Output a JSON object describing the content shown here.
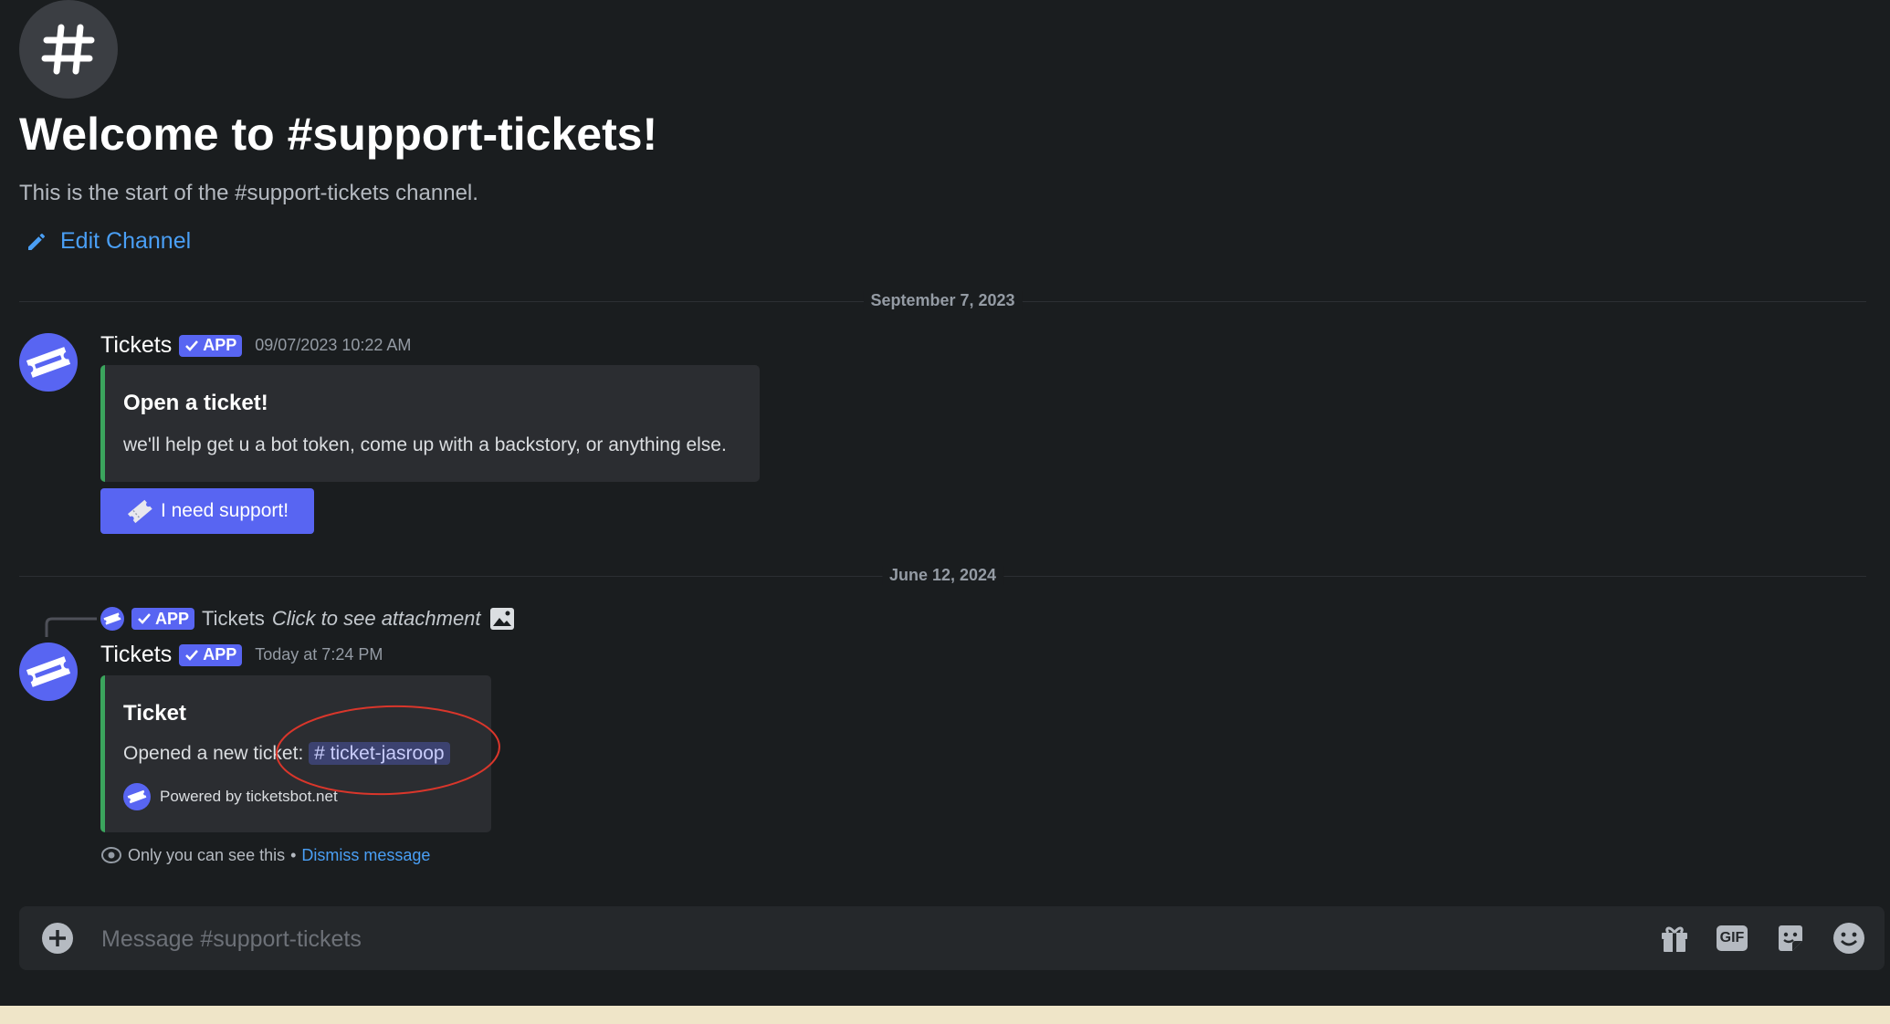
{
  "channel_header": {
    "icon": "hash-icon",
    "welcome_title": "Welcome to #support-tickets!",
    "welcome_subtitle": "This is the start of the #support-tickets channel.",
    "edit_channel_label": "Edit Channel",
    "edit_icon": "pencil-icon"
  },
  "dividers": [
    {
      "label": "September 7, 2023"
    },
    {
      "label": "June 12, 2024"
    }
  ],
  "messages": [
    {
      "author": "Tickets",
      "badge": "APP",
      "timestamp": "09/07/2023 10:22 AM",
      "embed": {
        "title": "Open a ticket!",
        "description": "we'll help get u a bot token, come up with a backstory, or anything else."
      },
      "button_label": "I need support!",
      "button_icon": "ticket-icon"
    },
    {
      "reply": {
        "badge": "APP",
        "author": "Tickets",
        "text": "Click to see attachment",
        "icon": "image-icon"
      },
      "author": "Tickets",
      "badge": "APP",
      "timestamp": "Today at 7:24 PM",
      "embed": {
        "title": "Ticket",
        "description_prefix": "Opened a new ticket:",
        "channel_mention": "ticket-jasroop",
        "footer": "Powered by ticketsbot.net"
      },
      "ephemeral": {
        "notice": "Only you can see this",
        "separator": "•",
        "dismiss_label": "Dismiss message"
      }
    }
  ],
  "composer": {
    "placeholder": "Message #support-tickets",
    "add_icon": "plus-circle-icon",
    "gift_icon": "gift-icon",
    "gif_label": "GIF",
    "sticker_icon": "sticker-icon",
    "emoji_icon": "emoji-icon"
  },
  "colors": {
    "background": "#1a1d1f",
    "accent": "#5865f2",
    "link": "#4a9ff5",
    "embed_border": "#3ba55d",
    "annotation": "#d9362b"
  }
}
